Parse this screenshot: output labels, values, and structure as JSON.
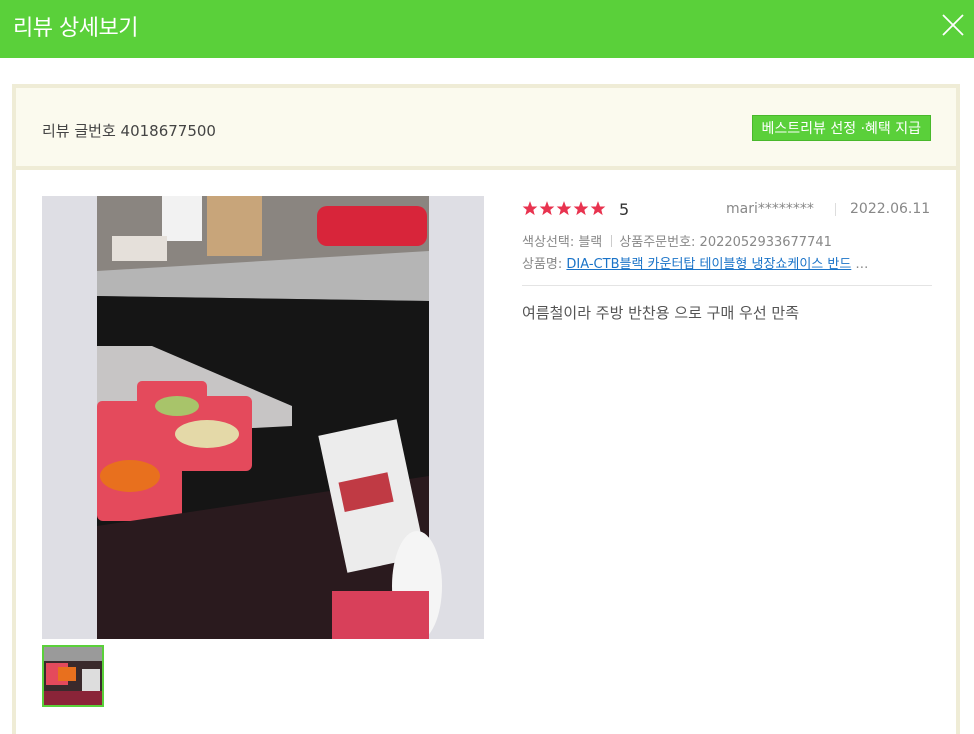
{
  "header": {
    "title": "리뷰 상세보기",
    "close_icon": "close-icon"
  },
  "info": {
    "review_number_label": "리뷰 글번호 4018677500",
    "best_review_button": "베스트리뷰 선정 ·혜택 지급"
  },
  "review": {
    "rating": 5,
    "rating_label": "5",
    "author": "mari********",
    "date": "2022.06.11",
    "option_label": "색상선택: 블랙",
    "order_label": "상품주문번호: 2022052933677741",
    "product_prefix": "상품명: ",
    "product_name": "DIA-CTB블랙 카운터탑 테이블형 냉장쇼케이스 반드",
    "product_ellipsis": " …",
    "text": "여름철이라 주방 반찬용 으로 구매 우선 만족"
  },
  "colors": {
    "accent": "#5ad03a",
    "star": "#e8334f",
    "link": "#1a73c8"
  }
}
